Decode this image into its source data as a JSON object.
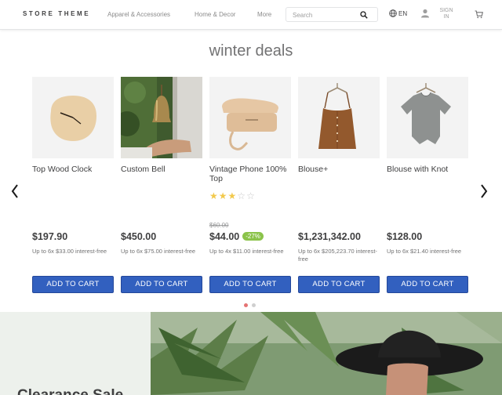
{
  "header": {
    "logo": "STORE THEME",
    "nav": [
      "Apparel & Accessories",
      "Home & Decor",
      "More"
    ],
    "search_placeholder": "Search",
    "language": "EN",
    "signin_line1": "SIGN",
    "signin_line2": "IN"
  },
  "section_title": "winter deals",
  "products": [
    {
      "name": "Top Wood Clock",
      "list_price": "",
      "price": "$197.90",
      "discount": "",
      "installments": "Up to 6x $33.00 interest-free",
      "button": "ADD TO CART",
      "rating": 0
    },
    {
      "name": "Custom Bell",
      "list_price": "",
      "price": "$450.00",
      "discount": "",
      "installments": "Up to 6x $75.00 interest-free",
      "button": "ADD TO CART",
      "rating": 0
    },
    {
      "name": "Vintage Phone 100% Top",
      "list_price": "$60.00",
      "price": "$44.00",
      "discount": "-27%",
      "installments": "Up to 4x $11.00 interest-free",
      "button": "ADD TO CART",
      "rating": 3
    },
    {
      "name": "Blouse+",
      "list_price": "",
      "price": "$1,231,342.00",
      "discount": "",
      "installments": "Up to 6x $205,223.70 interest-free",
      "button": "ADD TO CART",
      "rating": 0
    },
    {
      "name": "Blouse with Knot",
      "list_price": "",
      "price": "$128.00",
      "discount": "",
      "installments": "Up to 6x $21.40 interest-free",
      "button": "ADD TO CART",
      "rating": 0
    }
  ],
  "carousel": {
    "pages": 2,
    "active_page": 1,
    "active_color": "#e57373",
    "inactive_color": "#cfcfcf"
  },
  "hero": {
    "title": "Clearance Sale"
  },
  "colors": {
    "button": "#3260bf",
    "badge": "#8bc34a",
    "star": "#f2c94c"
  }
}
